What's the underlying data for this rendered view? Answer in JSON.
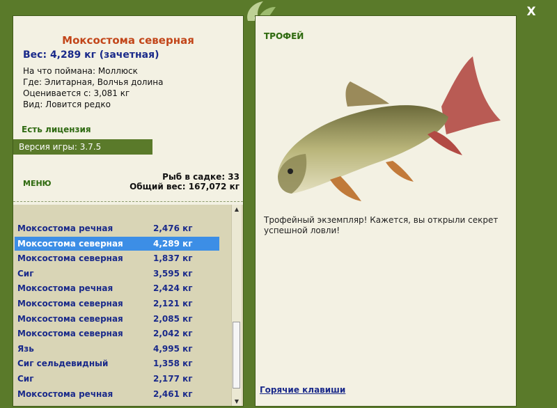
{
  "window": {
    "close_label": "X"
  },
  "left": {
    "fish_title": "Моксостома северная",
    "weight": "Вес: 4,289 кг (зачетная)",
    "caught_on": "На что поймана: Моллюск",
    "location": "Где: Элитарная, Волчья долина",
    "estimated": "Оценивается с: 3,081 кг",
    "kind": "Вид: Ловится редко",
    "license": "Есть лицензия",
    "version": "Версия игры: 3.7.5",
    "menu_label": "МЕНЮ",
    "cage_count": "Рыб в садке: 33",
    "total_weight": "Общий вес: 167,072 кг"
  },
  "catch_list": [
    {
      "name": "Моксостома речная",
      "weight": "2,476 кг"
    },
    {
      "name": "Моксостома северная",
      "weight": "4,289 кг",
      "selected": true
    },
    {
      "name": "Моксостома северная",
      "weight": "1,837 кг"
    },
    {
      "name": "Сиг",
      "weight": "3,595 кг"
    },
    {
      "name": "Моксостома речная",
      "weight": "2,424 кг"
    },
    {
      "name": "Моксостома северная",
      "weight": "2,121 кг"
    },
    {
      "name": "Моксостома северная",
      "weight": "2,085 кг"
    },
    {
      "name": "Моксостома северная",
      "weight": "2,042 кг"
    },
    {
      "name": "Язь",
      "weight": "4,995 кг"
    },
    {
      "name": "Сиг сельдевидный",
      "weight": "1,358 кг"
    },
    {
      "name": "Сиг",
      "weight": "2,177 кг"
    },
    {
      "name": "Моксостома речная",
      "weight": "2,461 кг"
    }
  ],
  "right": {
    "trophy_label": "ТРОФЕЙ",
    "trophy_text": "Трофейный экземпляр! Кажется, вы открыли секрет успешной ловли!",
    "hotkeys_label": "Горячие клавиши"
  },
  "colors": {
    "frame": "#5a7a2a",
    "panel": "#f3f1e3",
    "title": "#c2461a",
    "link": "#1a2a8a",
    "selected_row": "#3c8ee6",
    "list_bg": "#d9d5b6"
  },
  "icons": {
    "close": "close-icon",
    "logo": "leaf-logo-icon",
    "fish": "fish-image"
  }
}
